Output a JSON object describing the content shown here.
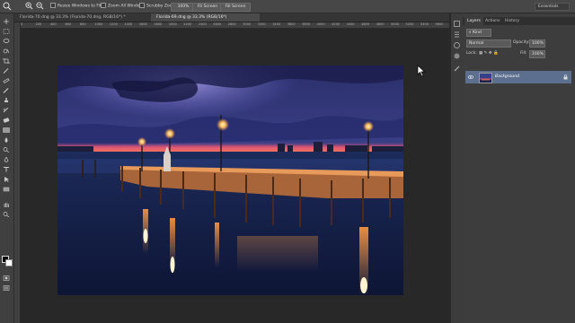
{
  "options_bar": {
    "resize_label": "Resize Windows to Fit",
    "zoom_all_label": "Zoom All Windows",
    "scrubby_label": "Scrubby Zoom",
    "btn_100": "100%",
    "btn_fit": "Fit Screen",
    "btn_fill": "Fill Screen",
    "workspace": "Essentials"
  },
  "document_tabs": [
    {
      "label": "Florida-70.dng @ 33.3% (Florida-70.dng, RGB/16*) *"
    },
    {
      "label": "Florida-69.dng @ 33.3% (RGB/16*)"
    }
  ],
  "ruler": {
    "top_ticks": [
      "0",
      "200",
      "400",
      "600",
      "800",
      "1000",
      "1200",
      "1400",
      "1600",
      "1800",
      "2000",
      "2200",
      "2400",
      "2600",
      "2800",
      "3000",
      "3200",
      "3400",
      "3600",
      "3800",
      "4000",
      "4200",
      "4400",
      "4600",
      "4800",
      "5000",
      "5200",
      "5400",
      "5600"
    ]
  },
  "panel": {
    "tabs": [
      "Layers",
      "Actions",
      "History"
    ],
    "active_tab": "Layers",
    "kind_label": "Kind",
    "blend_mode": "Normal",
    "opacity_label": "Opacity:",
    "opacity_value": "100%",
    "lock_label": "Lock:",
    "fill_label": "Fill:",
    "fill_value": "100%",
    "layers": [
      {
        "name": "Background",
        "selected": true
      }
    ]
  },
  "tools": [
    "move-icon",
    "marquee-icon",
    "lasso-icon",
    "quick-select-icon",
    "crop-icon",
    "eyedropper-icon",
    "healing-icon",
    "brush-icon",
    "clone-stamp-icon",
    "history-brush-icon",
    "eraser-icon",
    "gradient-icon",
    "blur-icon",
    "dodge-icon",
    "pen-icon",
    "type-icon",
    "path-select-icon",
    "shape-icon",
    "hand-icon",
    "zoom-icon"
  ],
  "colors": {
    "accent": "#5c6f8f",
    "sky_dark": "#1a1e4a",
    "horizon_pink": "#e0557a",
    "light_orange": "#ffb060"
  }
}
